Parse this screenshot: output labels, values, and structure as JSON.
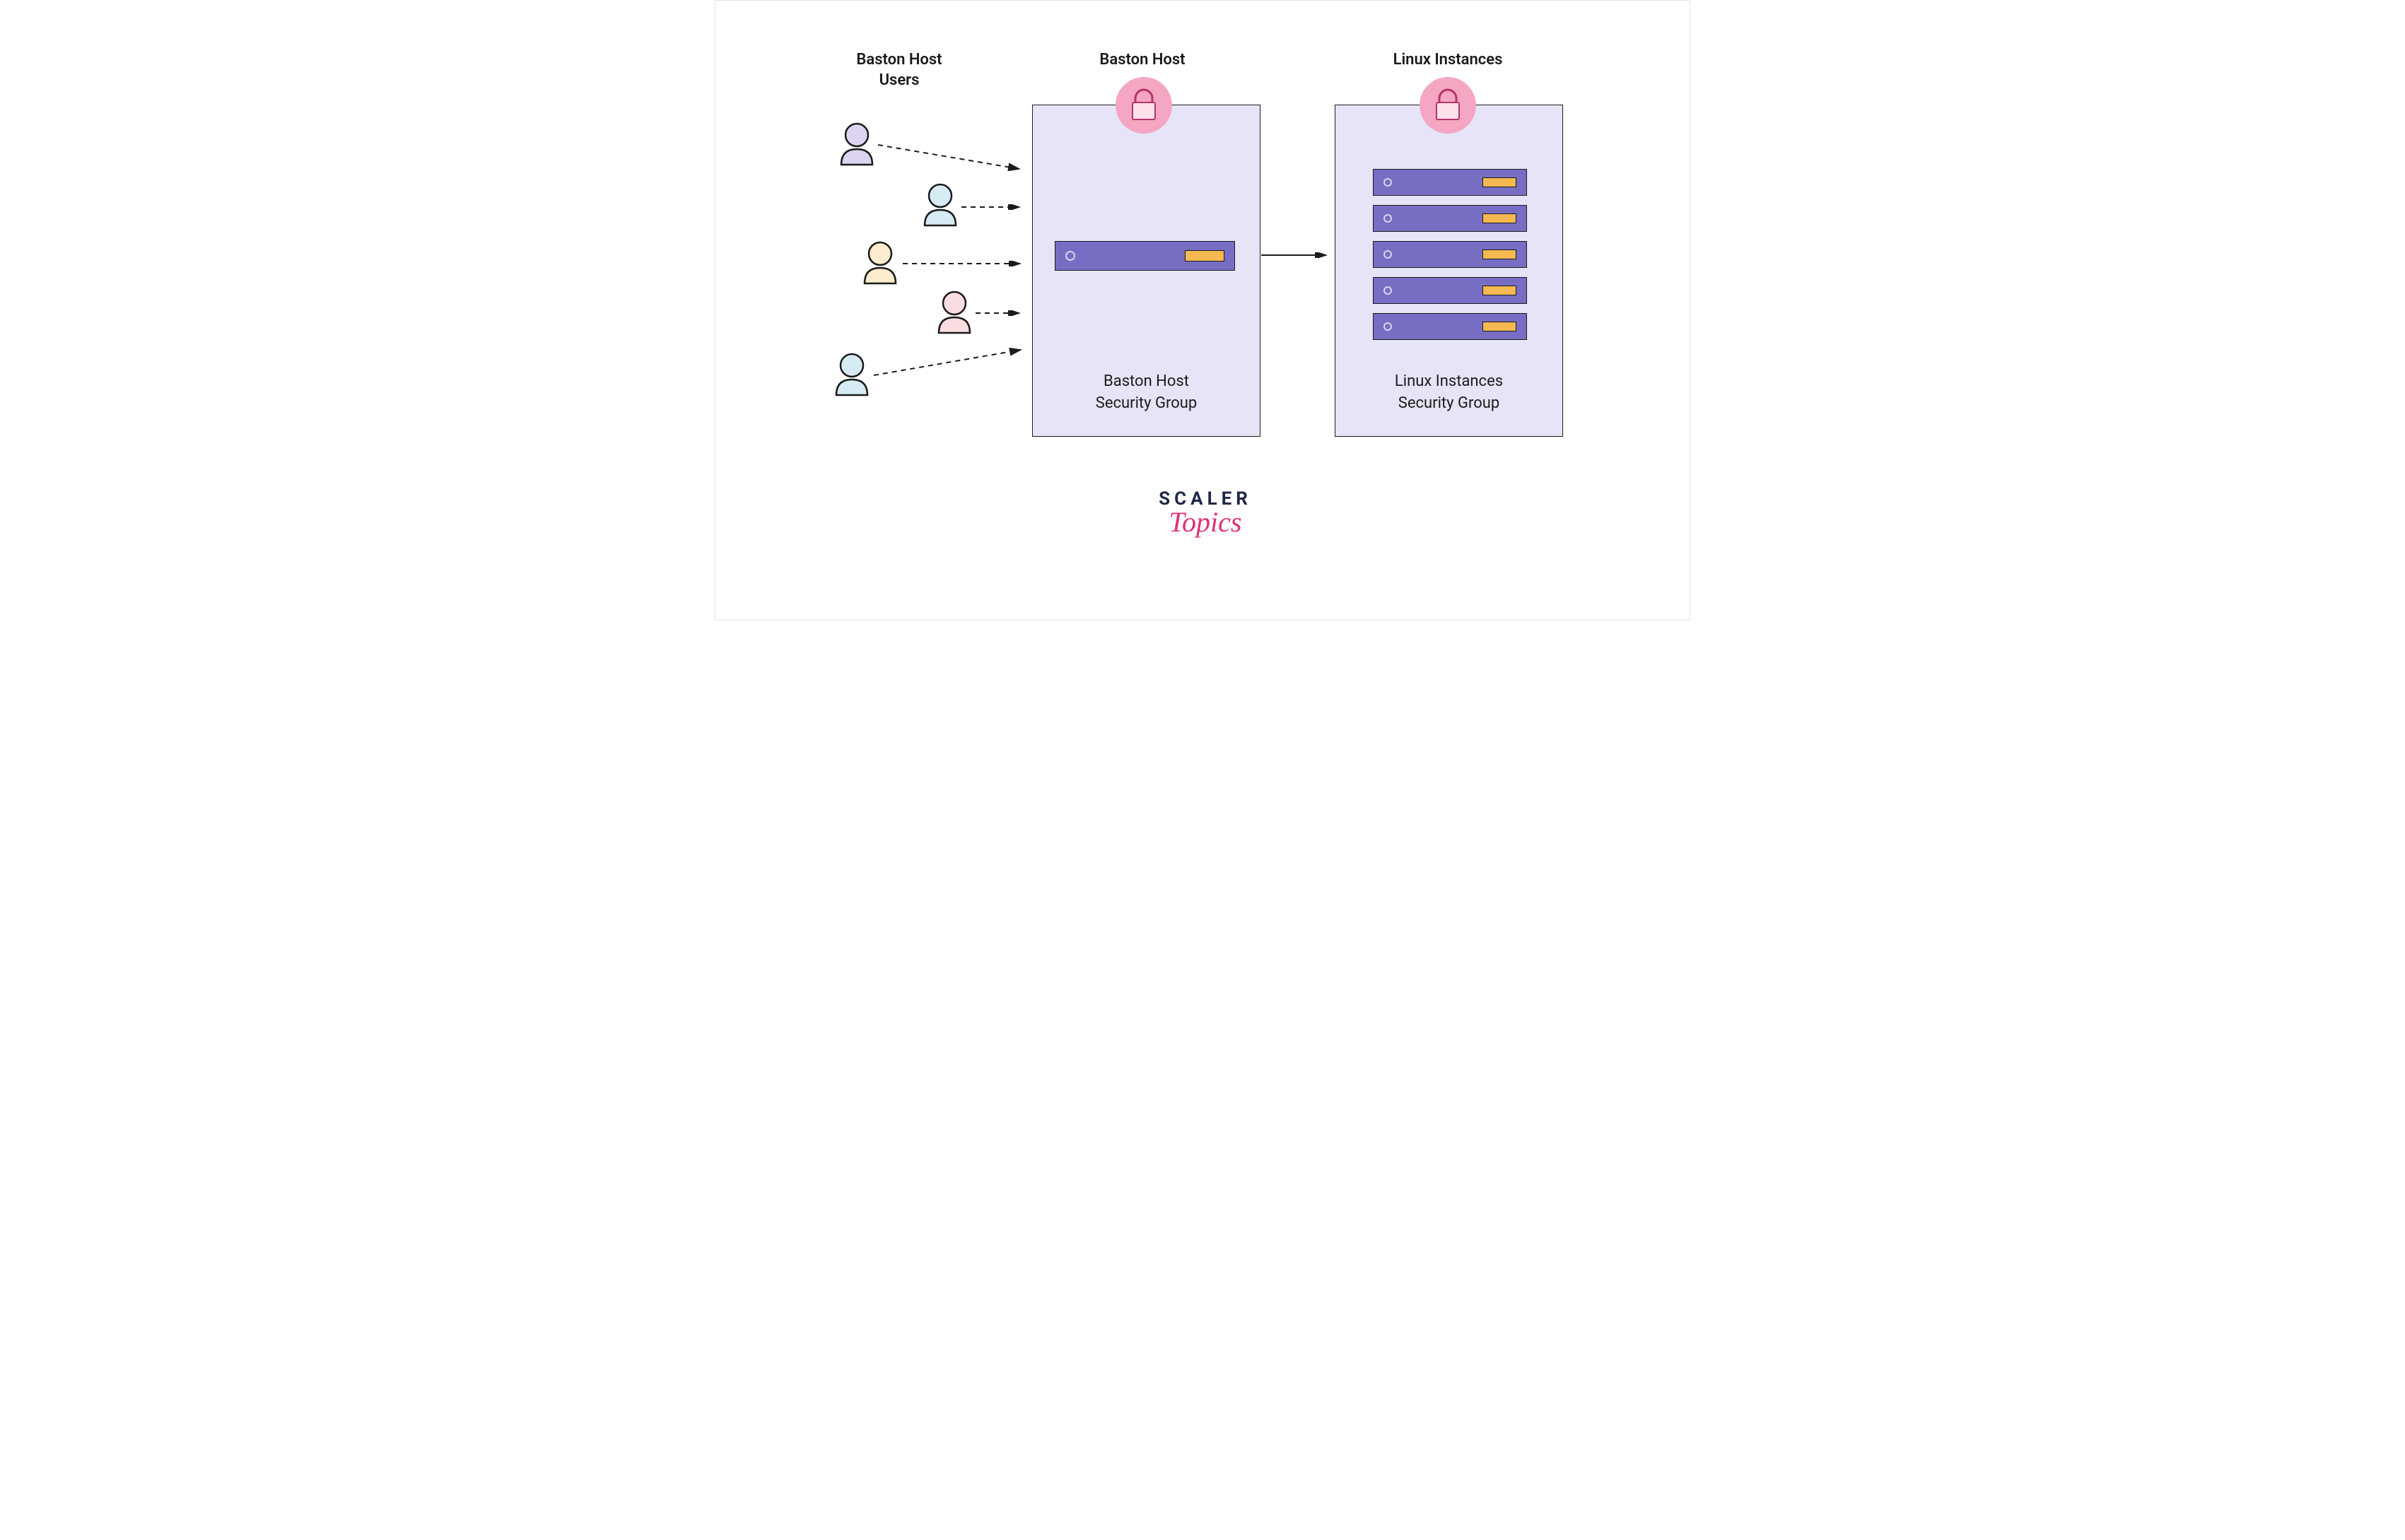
{
  "headers": {
    "users": "Baston Host\nUsers",
    "bastion": "Baston Host",
    "linux": "Linux Instances"
  },
  "groups": {
    "bastion_label": "Baston Host\nSecurity Group",
    "linux_label": "Linux Instances\nSecurity Group"
  },
  "logo": {
    "top": "SCALER",
    "bottom": "Topics"
  },
  "colors": {
    "user_a": "#dcd4f1",
    "user_b": "#d7ebf5",
    "user_c": "#faeccc",
    "user_d": "#fadde0",
    "user_e": "#d7ebf5",
    "box_bg": "#e7e4f7",
    "server_bg": "#776ec4",
    "lock_bg": "#f4a6c3",
    "lock_body": "#fbe1ea"
  }
}
